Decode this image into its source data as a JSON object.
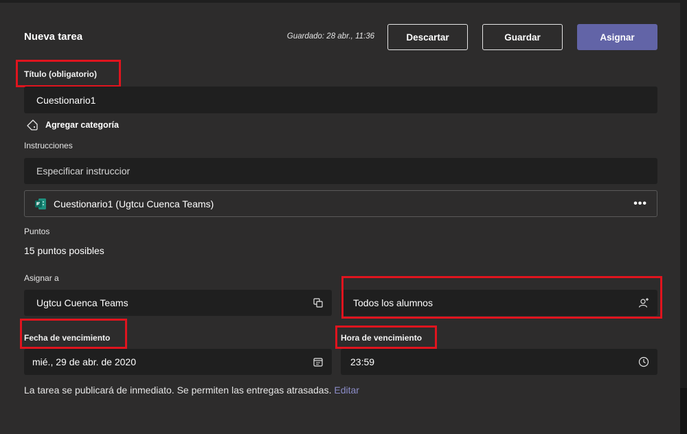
{
  "header": {
    "title": "Nueva tarea",
    "saved_text": "Guardado: 28 abr., 11:36",
    "discard_label": "Descartar",
    "save_label": "Guardar",
    "assign_label": "Asignar"
  },
  "title_field": {
    "label": "Título (obligatorio)",
    "value": "Cuestionario1"
  },
  "category": {
    "label": "Agregar categoría",
    "icon": "tag-icon"
  },
  "instructions": {
    "label": "Instrucciones",
    "placeholder": "Especificar instruccior"
  },
  "attachment": {
    "name": "Cuestionario1 (Ugtcu Cuenca Teams)",
    "icon": "forms-icon",
    "more": "•••"
  },
  "points": {
    "label": "Puntos",
    "value": "15 puntos posibles"
  },
  "assign_to": {
    "label": "Asignar a",
    "class_value": "Ugtcu Cuenca Teams",
    "students_value": "Todos los alumnos"
  },
  "due_date": {
    "label": "Fecha de vencimiento",
    "value": "mié., 29 de abr. de 2020"
  },
  "due_time": {
    "label": "Hora de vencimiento",
    "value": "23:59"
  },
  "footer": {
    "text": "La tarea se publicará de inmediato. Se permiten las entregas atrasadas.",
    "link": "Editar"
  },
  "colors": {
    "background": "#2d2c2c",
    "field": "#1f1f1f",
    "accent": "#6264a7",
    "highlight": "#e0141e"
  }
}
